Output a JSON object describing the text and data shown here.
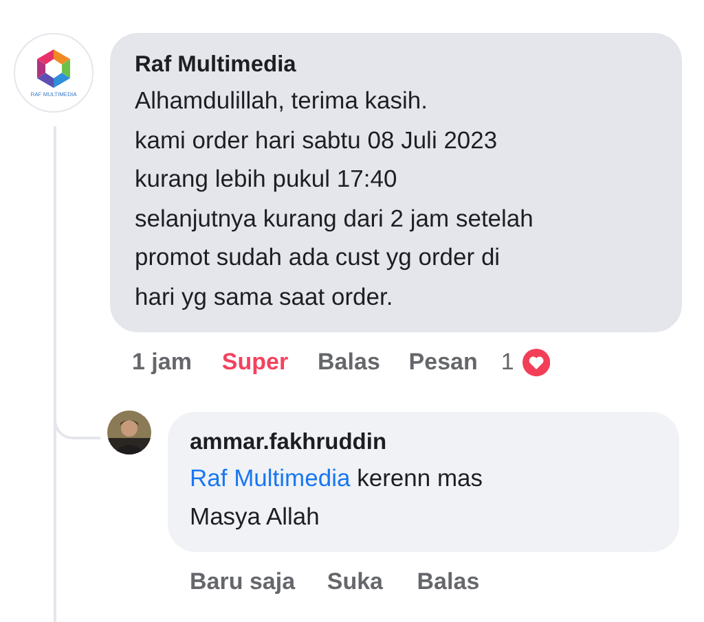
{
  "comment": {
    "author": "Raf Multimedia",
    "logo_text": "RAF MULTIMEDIA",
    "lines": [
      "Alhamdulillah, terima kasih.",
      "kami order hari sabtu 08 Juli 2023",
      "kurang lebih pukul 17:40",
      "selanjutnya kurang dari 2 jam setelah",
      "promot sudah ada cust yg order di",
      "hari yg sama saat order."
    ],
    "actions": [
      {
        "label": "1 jam",
        "selected": false
      },
      {
        "label": "Super",
        "selected": true
      },
      {
        "label": "Balas",
        "selected": false
      },
      {
        "label": "Pesan",
        "selected": false
      }
    ],
    "reaction_count": "1"
  },
  "reply": {
    "author": "ammar.fakhruddin",
    "parts": [
      {
        "text": "Raf Multimedia",
        "kind": "mention"
      },
      {
        "text": " kerenn mas Masya Allah",
        "kind": "text"
      }
    ],
    "actions": [
      {
        "label": "Baru saja",
        "selected": false
      },
      {
        "label": "Suka",
        "selected": false
      },
      {
        "label": "Balas",
        "selected": false
      }
    ]
  }
}
